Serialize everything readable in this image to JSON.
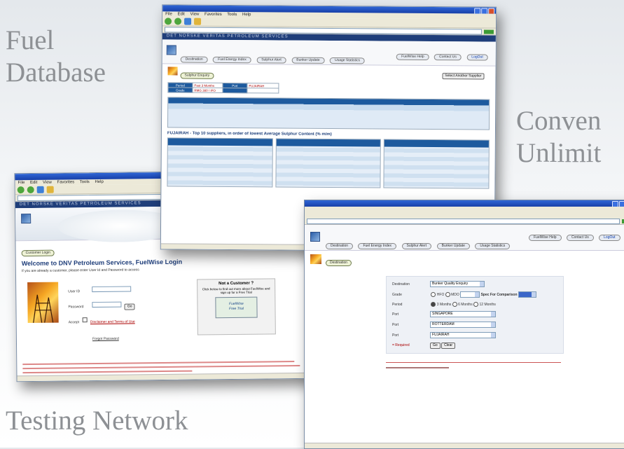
{
  "captions": {
    "fuel_database": [
      "Fuel",
      "Database"
    ],
    "convenience": [
      "Conven",
      "Unlimit"
    ],
    "testing_network": "Testing Network"
  },
  "browser": {
    "menu": [
      "File",
      "Edit",
      "View",
      "Favorites",
      "Tools",
      "Help"
    ],
    "banner": "DET NORSKE VERITAS PETROLEUM SERVICES"
  },
  "login_window": {
    "section_pill": "Customer Login",
    "welcome": "Welcome to DNV Petroleum Services, FuelWise Login",
    "intro": "If you are already a customer, please enter User Id and Password to access",
    "user_id_label": "User ID",
    "password_label": "Password",
    "go_button": "Go",
    "accept_label": "Accept",
    "disclaimer_link": "Disclaimer and Terms of Use",
    "forgot_link": "Forgot Password",
    "not_customer_title": "Not a Customer ?",
    "not_customer_text": "Click below to find out more about FuelWise and sign up for a Free Trial",
    "free_trial_card": [
      "FuelWise",
      "Free Trial"
    ]
  },
  "results_window": {
    "nav_tabs": [
      "Destination",
      "Fuel Energy Index",
      "Sulphur Alert",
      "Bunker Update",
      "Usage Statistics"
    ],
    "right_buttons": [
      "FuelWise Help",
      "Contact Us",
      "LogOut"
    ],
    "section_pill": "Sulphur Enquiry",
    "period_label": "Period",
    "period_value": "Past 3 Months",
    "port_label": "Port",
    "port_value": "FUJAIRAH",
    "grade_label": "Grade",
    "grade_value": "RMG 380 / IFO",
    "select_button": "Select Another Supplier",
    "top_suppliers_title": "FUJAIRAH - Top 10 suppliers, in order of lowest Average Sulphur Content (% m/m)"
  },
  "form_window": {
    "nav_tabs": [
      "Destination",
      "Fuel Energy Index",
      "Sulphur Alert",
      "Bunker Update",
      "Usage Statistics"
    ],
    "right_buttons": [
      "FuelWise Help",
      "Contact Us",
      "LogOut"
    ],
    "section_pill": "Destination",
    "destination_label": "Destination",
    "destination_value": "Bunker Quality Enquiry",
    "grade_label": "Grade",
    "grade_options": [
      "HFO",
      "MDO"
    ],
    "spec_label": "Spec For Comparison",
    "period_label": "Period",
    "period_options": [
      "3 Months",
      "6 Months",
      "12 Months"
    ],
    "ports": [
      {
        "label": "Port",
        "value": "SINGAPORE"
      },
      {
        "label": "Port",
        "value": "ROTTERDAM"
      },
      {
        "label": "Port",
        "value": "FUJAIRAH"
      }
    ],
    "required": "= Required",
    "go_button": "Go",
    "clear_button": "Clear"
  }
}
